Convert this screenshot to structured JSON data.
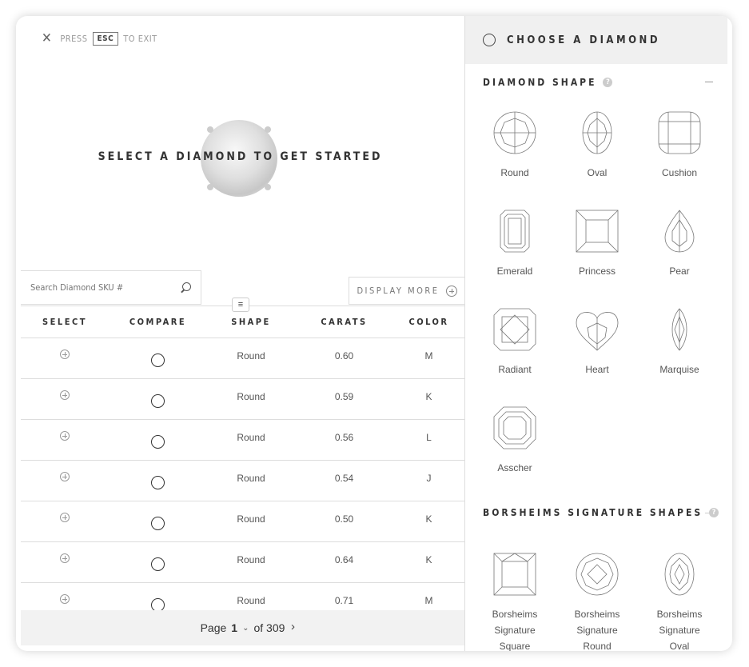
{
  "exit_bar": {
    "press": "PRESS",
    "key": "ESC",
    "to_exit": "TO EXIT"
  },
  "hero": {
    "text": "SELECT A DIAMOND TO GET STARTED"
  },
  "search": {
    "placeholder": "Search Diamond SKU #"
  },
  "display_more": {
    "label": "DISPLAY MORE"
  },
  "table": {
    "headers": [
      "SELECT",
      "COMPARE",
      "SHAPE",
      "CARATS",
      "COLOR"
    ],
    "rows": [
      {
        "shape": "Round",
        "carats": "0.60",
        "color": "M"
      },
      {
        "shape": "Round",
        "carats": "0.59",
        "color": "K"
      },
      {
        "shape": "Round",
        "carats": "0.56",
        "color": "L"
      },
      {
        "shape": "Round",
        "carats": "0.54",
        "color": "J"
      },
      {
        "shape": "Round",
        "carats": "0.50",
        "color": "K"
      },
      {
        "shape": "Round",
        "carats": "0.64",
        "color": "K"
      },
      {
        "shape": "Round",
        "carats": "0.71",
        "color": "M"
      }
    ]
  },
  "pager": {
    "page_word": "Page",
    "current": "1",
    "of_text": "of 309"
  },
  "panel": {
    "title": "CHOOSE A DIAMOND",
    "shape_section": "DIAMOND SHAPE",
    "shapes": [
      "Round",
      "Oval",
      "Cushion",
      "Emerald",
      "Princess",
      "Pear",
      "Radiant",
      "Heart",
      "Marquise",
      "Asscher"
    ],
    "signature_section": "BORSHEIMS SIGNATURE SHAPES",
    "signature_shapes": [
      {
        "l1": "Borsheims",
        "l2": "Signature",
        "l3": "Square"
      },
      {
        "l1": "Borsheims",
        "l2": "Signature",
        "l3": "Round"
      },
      {
        "l1": "Borsheims",
        "l2": "Signature",
        "l3": "Oval"
      }
    ]
  },
  "icons": {
    "close": "close-icon",
    "search": "search-icon",
    "add": "plus-circle-icon",
    "menu": "menu-icon",
    "help": "help-icon",
    "collapse": "minus-icon"
  }
}
